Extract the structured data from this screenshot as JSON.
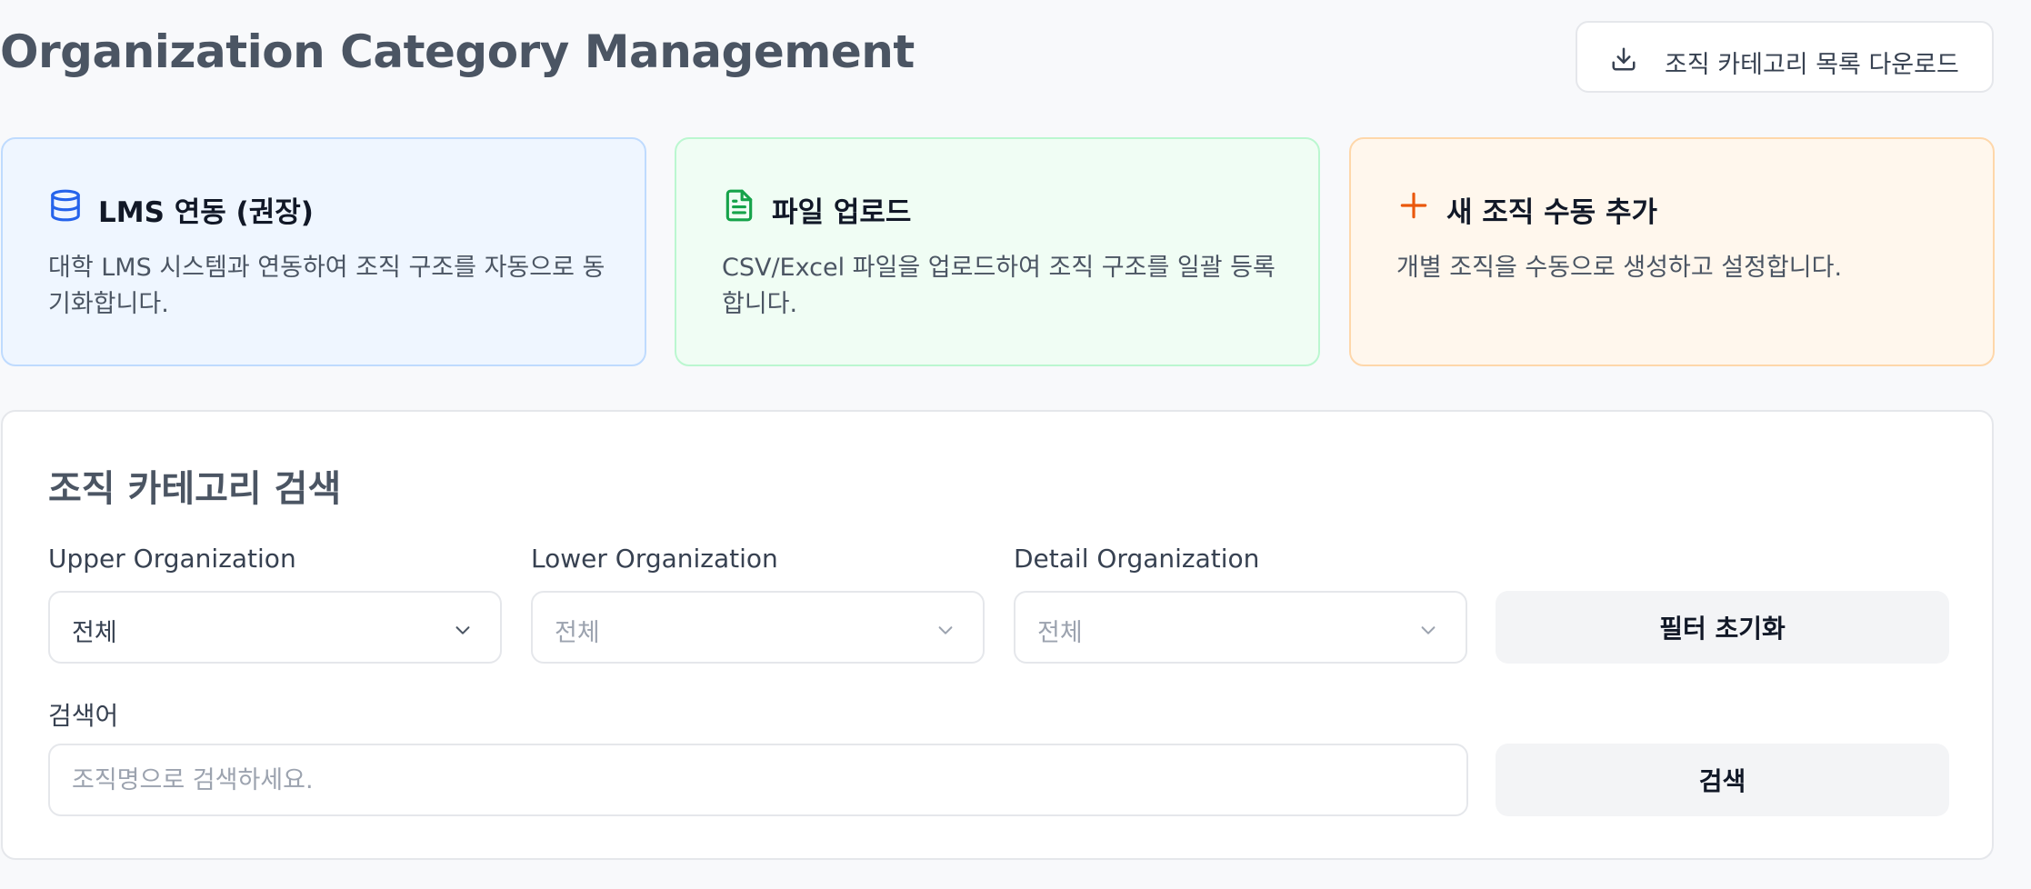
{
  "header": {
    "title": "Organization Category Management",
    "download_label": "조직 카테고리 목록 다운로드"
  },
  "cards": [
    {
      "icon": "database-icon",
      "title": "LMS 연동 (권장)",
      "description": "대학 LMS 시스템과 연동하여 조직 구조를 자동으로 동기화합니다.",
      "color": "#2563eb"
    },
    {
      "icon": "file-text-icon",
      "title": "파일 업로드",
      "description": "CSV/Excel 파일을 업로드하여 조직 구조를 일괄 등록합니다.",
      "color": "#16a34a"
    },
    {
      "icon": "plus-icon",
      "title": "새 조직 수동 추가",
      "description": "개별 조직을 수동으로 생성하고 설정합니다.",
      "color": "#ea580c"
    }
  ],
  "search_panel": {
    "title": "조직 카테고리 검색",
    "filters": [
      {
        "label": "Upper Organization",
        "value": "전체",
        "disabled": false
      },
      {
        "label": "Lower Organization",
        "value": "전체",
        "disabled": true
      },
      {
        "label": "Detail Organization",
        "value": "전체",
        "disabled": true
      }
    ],
    "reset_label": "필터 초기화",
    "keyword_label": "검색어",
    "keyword_placeholder": "조직명으로 검색하세요.",
    "keyword_value": "",
    "search_label": "검색"
  }
}
